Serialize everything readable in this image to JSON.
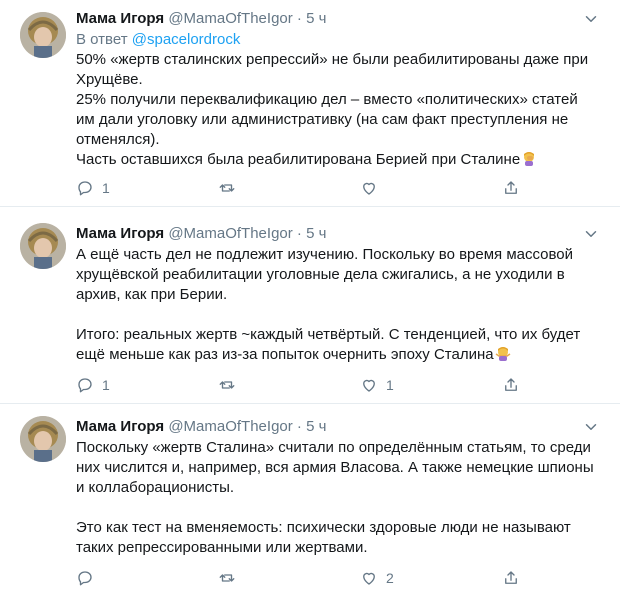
{
  "tweets": [
    {
      "name": "Мама Игоря",
      "handle": "@MamaOfTheIgor",
      "dot": "·",
      "time": "5 ч",
      "reply_prefix": "В ответ ",
      "reply_to": "@spacelordrock",
      "paragraphs": [
        "50% «жертв сталинских репрессий» не были реабилитированы даже при Хрущёве.",
        "25% получили переквалификацию дел – вместо «политических» статей им дали уголовку или административку (на сам факт преступления не отменялся).",
        "Часть оставшихся была реабилитирована Берией при Сталине"
      ],
      "reply_count": "1",
      "retweet_count": "",
      "like_count": ""
    },
    {
      "name": "Мама Игоря",
      "handle": "@MamaOfTheIgor",
      "dot": "·",
      "time": "5 ч",
      "paragraphs": [
        "А ещё часть дел не подлежит изучению. Поскольку во время массовой хрущёвской реабилитации уголовные дела сжигались, а не уходили в архив, как при Берии.\n\nИтого: реальных жертв ~каждый четвёртый. С тенденцией, что их будет ещё меньше как раз из-за попыток очернить эпоху Сталина"
      ],
      "reply_count": "1",
      "retweet_count": "",
      "like_count": "1"
    },
    {
      "name": "Мама Игоря",
      "handle": "@MamaOfTheIgor",
      "dot": "·",
      "time": "5 ч",
      "paragraphs": [
        "Поскольку «жертв Сталина» считали по определённым статьям, то среди них числится и, например, вся армия Власова. А также немецкие шпионы и коллаборационисты.\n\nЭто как тест на вменяемость: психически здоровые люди не называют таких репрессированными или жертвами."
      ],
      "reply_count": "",
      "retweet_count": "",
      "like_count": "2"
    }
  ],
  "colors": {
    "text": "#14171a",
    "secondary": "#657786",
    "link": "#1da1f2",
    "divider": "#e6ecf0"
  }
}
